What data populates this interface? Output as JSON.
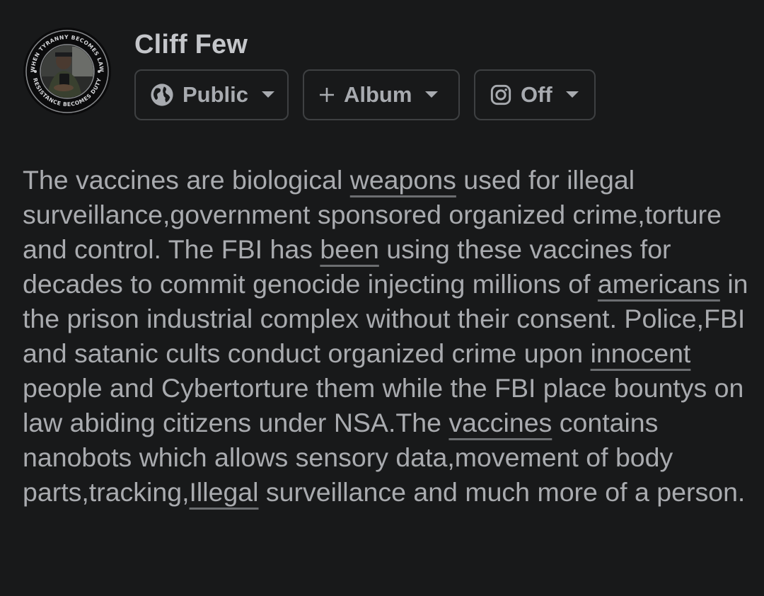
{
  "profile": {
    "name": "Cliff Few",
    "avatar_top_text": "WHEN TYRANNY BECOMES LAW",
    "avatar_bottom_text": "RESISTANCE BECOMES DUTY"
  },
  "controls": {
    "audience": {
      "label": "Public",
      "icon": "globe-icon"
    },
    "album": {
      "label": "Album",
      "icon": "plus-icon"
    },
    "instagram": {
      "label": "Off",
      "icon": "instagram-icon"
    }
  },
  "post": {
    "segments": [
      {
        "text": "The vaccines are biological ",
        "underline": false
      },
      {
        "text": "weapons",
        "underline": true
      },
      {
        "text": " used for illegal surveillance,government sponsored organized crime,torture and control. The FBI has ",
        "underline": false
      },
      {
        "text": "been",
        "underline": true
      },
      {
        "text": " using these vaccines for decades to commit genocide injecting millions of ",
        "underline": false
      },
      {
        "text": "americans",
        "underline": true
      },
      {
        "text": " in the prison industrial complex without their consent. Police,FBI and satanic cults conduct organized crime upon ",
        "underline": false
      },
      {
        "text": "innocent",
        "underline": true
      },
      {
        "text": " people and Cybertorture them while the FBI place bountys on law abiding citizens under NSA.The ",
        "underline": false
      },
      {
        "text": "vaccines",
        "underline": true
      },
      {
        "text": " contains nanobots which allows sensory data,movement of body parts,tracking,",
        "underline": false
      },
      {
        "text": "Illegal",
        "underline": true
      },
      {
        "text": " surveillance and much more of a person.",
        "underline": false
      }
    ]
  },
  "colors": {
    "background": "#18191a",
    "text": "#a9abaf",
    "border": "#3e4042"
  }
}
